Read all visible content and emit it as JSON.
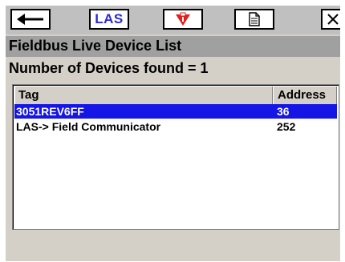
{
  "toolbar": {
    "back": {
      "icon": "back-arrow-icon"
    },
    "las": {
      "label": "LAS"
    },
    "field_communicator": {
      "icon": "field-communicator-icon",
      "color": "#e0201c"
    },
    "document": {
      "icon": "document-icon"
    },
    "close": {
      "icon": "close-icon"
    }
  },
  "title": "Fieldbus Live Device List",
  "device_count_text": "Number of Devices found = 1",
  "table": {
    "columns": [
      "Tag",
      "Address"
    ],
    "rows": [
      {
        "tag": "3051REV6FF",
        "address": "36",
        "selected": true
      },
      {
        "tag": "LAS-> Field Communicator",
        "address": "252",
        "selected": false
      }
    ]
  },
  "colors": {
    "selection": "#1515e6",
    "las_text": "#2b2bd6",
    "title_band": "#a0a0a0",
    "background": "#d4d0c8"
  }
}
